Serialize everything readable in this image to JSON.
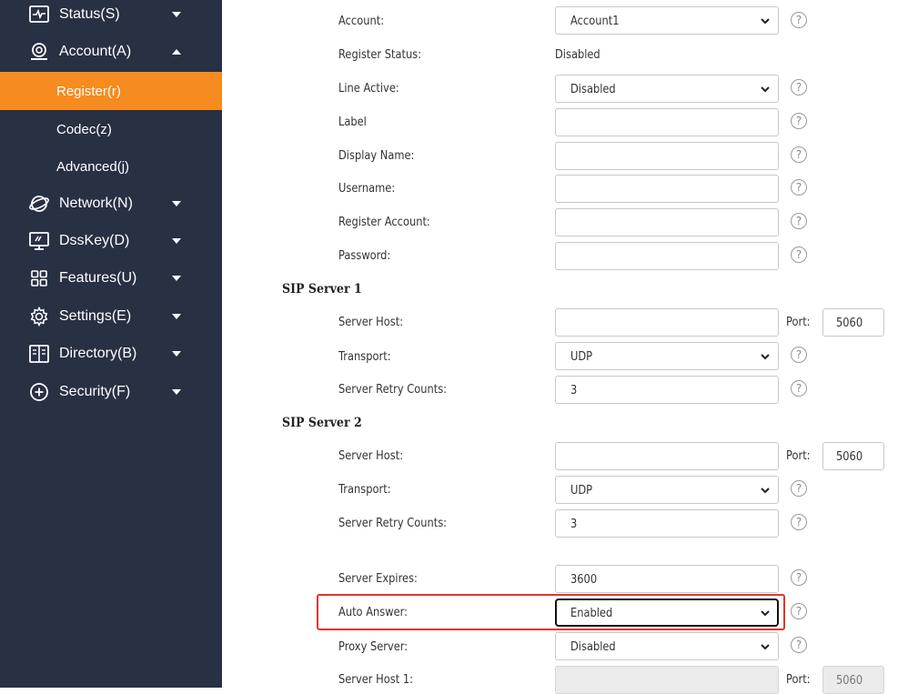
{
  "sidebar": {
    "items": [
      {
        "label": "Status(S)",
        "icon": "status-icon",
        "caret": "down"
      },
      {
        "label": "Account(A)",
        "icon": "account-icon",
        "caret": "up"
      },
      {
        "label": "Network(N)",
        "icon": "network-icon",
        "caret": "down"
      },
      {
        "label": "DssKey(D)",
        "icon": "dsskey-icon",
        "caret": "down"
      },
      {
        "label": "Features(U)",
        "icon": "features-icon",
        "caret": "down"
      },
      {
        "label": "Settings(E)",
        "icon": "settings-icon",
        "caret": "down"
      },
      {
        "label": "Directory(B)",
        "icon": "directory-icon",
        "caret": "down"
      },
      {
        "label": "Security(F)",
        "icon": "security-icon",
        "caret": "down"
      }
    ],
    "subitems": [
      {
        "label": "Register(r)",
        "active": true
      },
      {
        "label": "Codec(z)",
        "active": false
      },
      {
        "label": "Advanced(j)",
        "active": false
      }
    ],
    "colors": {
      "background": "#283044",
      "active": "#f68b1f"
    }
  },
  "form": {
    "account": {
      "label": "Account:",
      "value": "Account1"
    },
    "register_status": {
      "label": "Register Status:",
      "value": "Disabled"
    },
    "line_active": {
      "label": "Line Active:",
      "value": "Disabled"
    },
    "label_field": {
      "label": "Label",
      "value": ""
    },
    "display_name": {
      "label": "Display Name:",
      "value": ""
    },
    "username": {
      "label": "Username:",
      "value": ""
    },
    "register_account": {
      "label": "Register Account:",
      "value": ""
    },
    "password": {
      "label": "Password:",
      "value": ""
    },
    "sip1": {
      "title": "SIP Server 1",
      "host_label": "Server Host:",
      "host_value": "",
      "port_label": "Port:",
      "port_value": "5060",
      "transport_label": "Transport:",
      "transport_value": "UDP",
      "retry_label": "Server Retry Counts:",
      "retry_value": "3"
    },
    "sip2": {
      "title": "SIP Server 2",
      "host_label": "Server Host:",
      "host_value": "",
      "port_label": "Port:",
      "port_value": "5060",
      "transport_label": "Transport:",
      "transport_value": "UDP",
      "retry_label": "Server Retry Counts:",
      "retry_value": "3"
    },
    "server_expires": {
      "label": "Server Expires:",
      "value": "3600"
    },
    "auto_answer": {
      "label": "Auto Answer:",
      "value": "Enabled"
    },
    "proxy_server": {
      "label": "Proxy Server:",
      "value": "Disabled"
    },
    "server_host_1": {
      "label": "Server Host 1:",
      "value": "",
      "port_label": "Port:",
      "port_value": "5060"
    },
    "help_glyph": "?"
  },
  "colors": {
    "highlight": "#e8332a"
  }
}
